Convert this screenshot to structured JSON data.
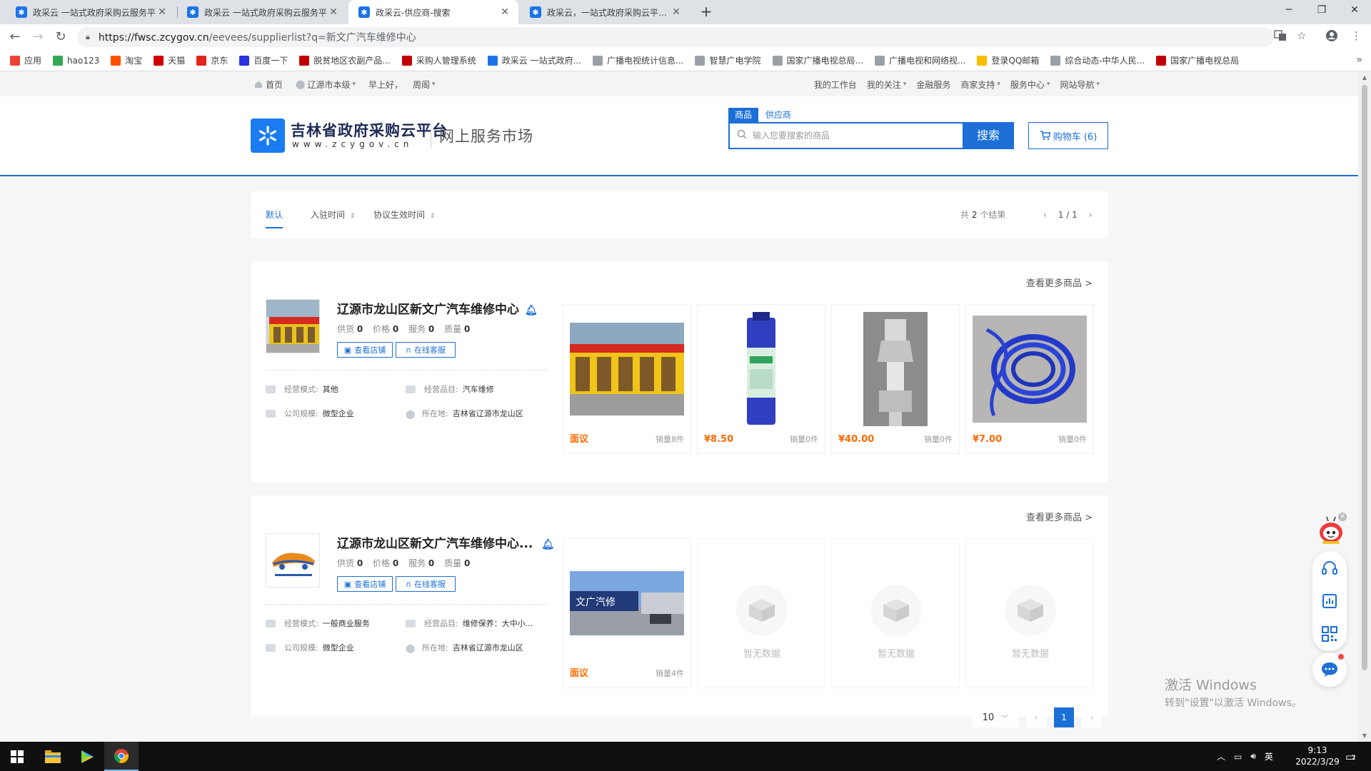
{
  "browser": {
    "tabs": [
      {
        "title": "政采云 一站式政府采购云服务平",
        "active": false
      },
      {
        "title": "政采云 一站式政府采购云服务平",
        "active": false
      },
      {
        "title": "政采云-供应商-搜索",
        "active": true
      },
      {
        "title": "政采云，一站式政府采购云平台-",
        "active": false
      }
    ],
    "url_host": "https://fwsc.zcygov.cn",
    "url_path": "/eevees/supplierlist?q=新文广汽车维修中心",
    "bookmarks": [
      {
        "label": "应用",
        "color": "#ea4335"
      },
      {
        "label": "hao123",
        "color": "#34a853"
      },
      {
        "label": "淘宝",
        "color": "#ff5000"
      },
      {
        "label": "天猫",
        "color": "#d00000"
      },
      {
        "label": "京东",
        "color": "#e1251b"
      },
      {
        "label": "百度一下",
        "color": "#2932e1"
      },
      {
        "label": "脱贫地区农副产品...",
        "color": "#c00000"
      },
      {
        "label": "采购人管理系统",
        "color": "#c00000"
      },
      {
        "label": "政采云 一站式政府...",
        "color": "#1a73e8"
      },
      {
        "label": "广播电视统计信息...",
        "color": "#9aa0a6"
      },
      {
        "label": "智慧广电学院",
        "color": "#9aa0a6"
      },
      {
        "label": "国家广播电视总局...",
        "color": "#9aa0a6"
      },
      {
        "label": "广播电视和网络视...",
        "color": "#9aa0a6"
      },
      {
        "label": "登录QQ邮箱",
        "color": "#fbbc04"
      },
      {
        "label": "综合动态-中华人民...",
        "color": "#9aa0a6"
      },
      {
        "label": "国家广播电视总局",
        "color": "#c00000"
      }
    ]
  },
  "topnav": {
    "home": "首页",
    "region": "辽源市本级",
    "greeting": "早上好，",
    "user": "周阁",
    "right": [
      {
        "label": "我的工作台",
        "caret": false
      },
      {
        "label": "我的关注",
        "caret": true
      },
      {
        "label": "金融服务",
        "caret": false
      },
      {
        "label": "商家支持",
        "caret": true
      },
      {
        "label": "服务中心",
        "caret": true
      },
      {
        "label": "网站导航",
        "caret": true
      }
    ]
  },
  "header": {
    "title": "吉林省政府采购云平台",
    "domain": "www.zcygov.cn",
    "subtitle": "网上服务市场",
    "search_tab_goods": "商品",
    "search_tab_supplier": "供应商",
    "search_placeholder": "输入您要搜索的商品",
    "search_button": "搜索",
    "cart_label": "购物车 (6)"
  },
  "sortbar": {
    "default": "默认",
    "join_time": "入驻时间",
    "agreement_time": "协议生效时间",
    "count_prefix": "共",
    "count": "2",
    "count_suffix": "个结果",
    "page": "1 / 1"
  },
  "suppliers": [
    {
      "name": "辽源市龙山区新文广汽车维修中心",
      "stats": [
        {
          "label": "供货",
          "value": "0"
        },
        {
          "label": "价格",
          "value": "0"
        },
        {
          "label": "服务",
          "value": "0"
        },
        {
          "label": "质量",
          "value": "0"
        }
      ],
      "view_shop": "查看店铺",
      "online_service": "在线客服",
      "biz_mode_label": "经营模式:",
      "biz_mode": "其他",
      "biz_category_label": "经营品目:",
      "biz_category": "汽车维修",
      "scale_label": "公司规模:",
      "scale": "微型企业",
      "location_label": "所在地:",
      "location": "吉林省辽源市龙山区",
      "more": "查看更多商品 >",
      "products": [
        {
          "price": "面议",
          "sales": "销量8件"
        },
        {
          "price": "¥8.50",
          "sales": "销量0件"
        },
        {
          "price": "¥40.00",
          "sales": "销量0件"
        },
        {
          "price": "¥7.00",
          "sales": "销量0件"
        }
      ]
    },
    {
      "name": "辽源市龙山区新文广汽车维修中心...",
      "stats": [
        {
          "label": "供货",
          "value": "0"
        },
        {
          "label": "价格",
          "value": "0"
        },
        {
          "label": "服务",
          "value": "0"
        },
        {
          "label": "质量",
          "value": "0"
        }
      ],
      "view_shop": "查看店铺",
      "online_service": "在线客服",
      "biz_mode_label": "经营模式:",
      "biz_mode": "一般商业服务",
      "biz_category_label": "经营品目:",
      "biz_category": "维修保养：大中小...",
      "scale_label": "公司规模:",
      "scale": "微型企业",
      "location_label": "所在地:",
      "location": "吉林省辽源市龙山区",
      "more": "查看更多商品 >",
      "products": [
        {
          "price": "面议",
          "sales": "销量4件"
        }
      ],
      "empty_text": "暂无数据",
      "sign_text": "文广汽修"
    }
  ],
  "pagination": {
    "page_size": "10",
    "current": "1"
  },
  "watermark": {
    "line1": "激活 Windows",
    "line2": "转到\"设置\"以激活 Windows。"
  },
  "taskbar": {
    "time": "9:13",
    "date": "2022/3/29",
    "ime": "英",
    "notif": "2"
  },
  "colors": {
    "brand_blue": "#1c6fd6",
    "price_orange": "#ff6a00"
  }
}
